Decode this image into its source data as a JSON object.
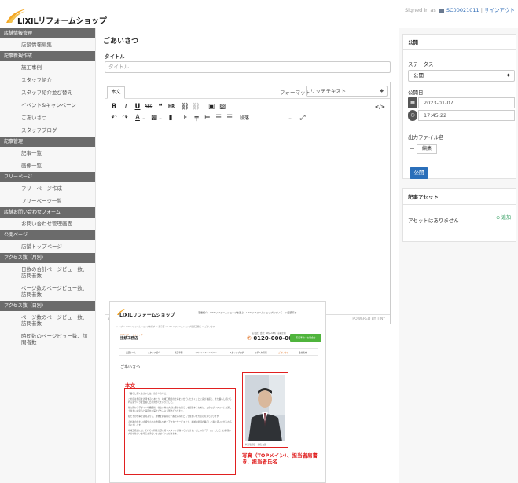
{
  "header": {
    "logo_text": "LIXILリフォームショップ",
    "signed_in_prefix": "Signed in as",
    "user_id": "SC00021011",
    "separator": "|",
    "signout_label": "サインアウト"
  },
  "sidebar": {
    "sections": [
      {
        "title": "店舗情報管理",
        "items": [
          "店舗情報編集"
        ]
      },
      {
        "title": "記事新規作成",
        "items": [
          "施工事例",
          "スタッフ紹介",
          "スタッフ紹介並び替え",
          "イベント&キャンペーン",
          "ごあいさつ",
          "スタッフブログ"
        ]
      },
      {
        "title": "記事管理",
        "items": [
          "記事一覧",
          "画像一覧"
        ]
      },
      {
        "title": "フリーページ",
        "items": [
          "フリーページ作成",
          "フリーページ一覧"
        ]
      },
      {
        "title": "店舗お問い合わせフォーム",
        "items": [
          "お問い合わせ管理画面"
        ]
      },
      {
        "title": "公開ページ",
        "items": [
          "店舗トップページ"
        ]
      },
      {
        "title": "アクセス数（月別）",
        "items": [
          "日数の合計ページビュー数、訪問者数",
          "ページ数のページビュー数、訪問者数"
        ]
      },
      {
        "title": "アクセス数（日別）",
        "items": [
          "ページ数のページビュー数、訪問者数",
          "時間数のページビュー数、訪問者数"
        ]
      }
    ]
  },
  "main": {
    "page_title": "ごあいさつ",
    "title_label": "タイトル",
    "title_placeholder": "タイトル",
    "editor": {
      "tab_label": "本文",
      "format_label": "フォーマット",
      "format_value": "リッチテキスト",
      "format_caret": "◆",
      "paragraph_label": "段落",
      "code_label": "</>",
      "status_path": "p",
      "powered_by": "POWERED BY TINY"
    }
  },
  "preview": {
    "logo": "LIXILリフォームショップ",
    "topnav": "事業紹介　LIXILリフォームショップを選ぶ　LIXILリフォームショップについて　Q 店舗探す",
    "breadcrumb": "トップ ＞ LIXILリフォームショップを探す ＞ 東京都 ＞ LIXILリフォームショップ接続工務店 ＞ ごあいさつ",
    "shop_sub": "LIXILリフォームショップ",
    "shop_name": "接続工務店",
    "tel_sub": "お電話・受付：9時〜18時（水曜定休）",
    "tel": "0120-000-000",
    "cta": "来店予約・お問合せ",
    "menu": [
      "店舗ホーム",
      "スタッフ紹介",
      "施工事例",
      "イベント&キャンペーン",
      "スタッフブログ",
      "お手入れ情報",
      "ごあいさつ",
      "会社案内"
    ],
    "section_heading": "ごあいさつ",
    "body_label": "本文",
    "body_paragraphs": [
      "「暮らし輝く住まいとは、住う人の幸せ」",
      "この度は弊店を訪問するにあたり、地域工務店の仕事をさせていただくことに喜びを感じ、また暮らし続けられる家づくりを目指し日々努めてまいりました。",
      "住に関わるデザインや機能性、住む心地を大切に豊かな暮らしを提案するために、このたびリフォームを通して住まいの安心と満足をお届けできるよう努めております。",
      "私たちの仕事では何よりも、建物をお客様に一番近い存在として住まいを大切に考えております。",
      "その後の住まい点検や小さな修繕も含めたアフターサービスまで、地域の皆様の暮らしに寄り添いながらお応えいたします。",
      "地域工務店には、それぞれ得意分野を持つスタッフが揃っております。ひとつの「チーム」として、お客様の大切な住まいを守るお手伝いをさせていただきます。"
    ],
    "photo_caption": "代表取締役　接続 太郎",
    "photo_note": "写真（TOPメイン）、担当者肩書き、担当者氏名"
  },
  "right_panel": {
    "publish_card": {
      "title": "公開",
      "status_label": "ステータス",
      "status_value": "公開",
      "status_caret": "◆",
      "date_label": "公開日",
      "date_value": "2023-01-07",
      "time_value": "17:45:22",
      "filename_label": "出力ファイル名",
      "edit_label": "編集",
      "publish_button": "公開"
    },
    "asset_card": {
      "title": "記事アセット",
      "add_label": "⊕ 追加",
      "empty_text": "アセットはありません"
    }
  }
}
